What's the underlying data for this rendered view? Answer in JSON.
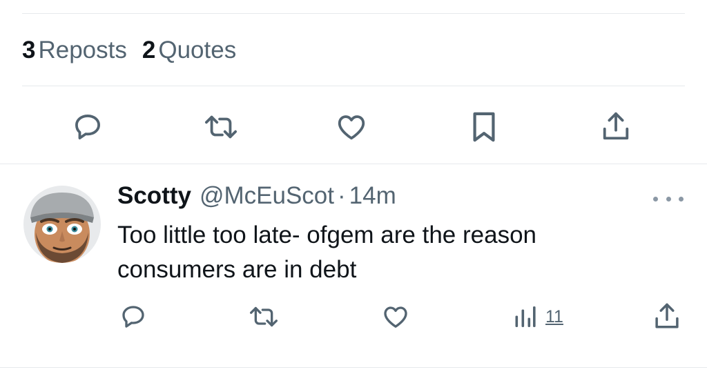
{
  "stats": {
    "reposts_count": "3",
    "reposts_label": "Reposts",
    "quotes_count": "2",
    "quotes_label": "Quotes"
  },
  "main_actions": {
    "icons": [
      "reply-icon",
      "repost-icon",
      "like-icon",
      "bookmark-icon",
      "share-icon"
    ]
  },
  "reply": {
    "name": "Scotty",
    "handle": "@McEuScot",
    "separator": "·",
    "time": "14m",
    "text": "Too little too late- ofgem are the reason consumers are in debt",
    "views_count": "11",
    "icons": [
      "reply-icon",
      "repost-icon",
      "like-icon",
      "views-icon",
      "share-icon",
      "more-icon"
    ]
  },
  "colors": {
    "icon": "#536471",
    "divider": "#e6e9ec",
    "text": "#0f1419",
    "secondary": "#536471"
  }
}
